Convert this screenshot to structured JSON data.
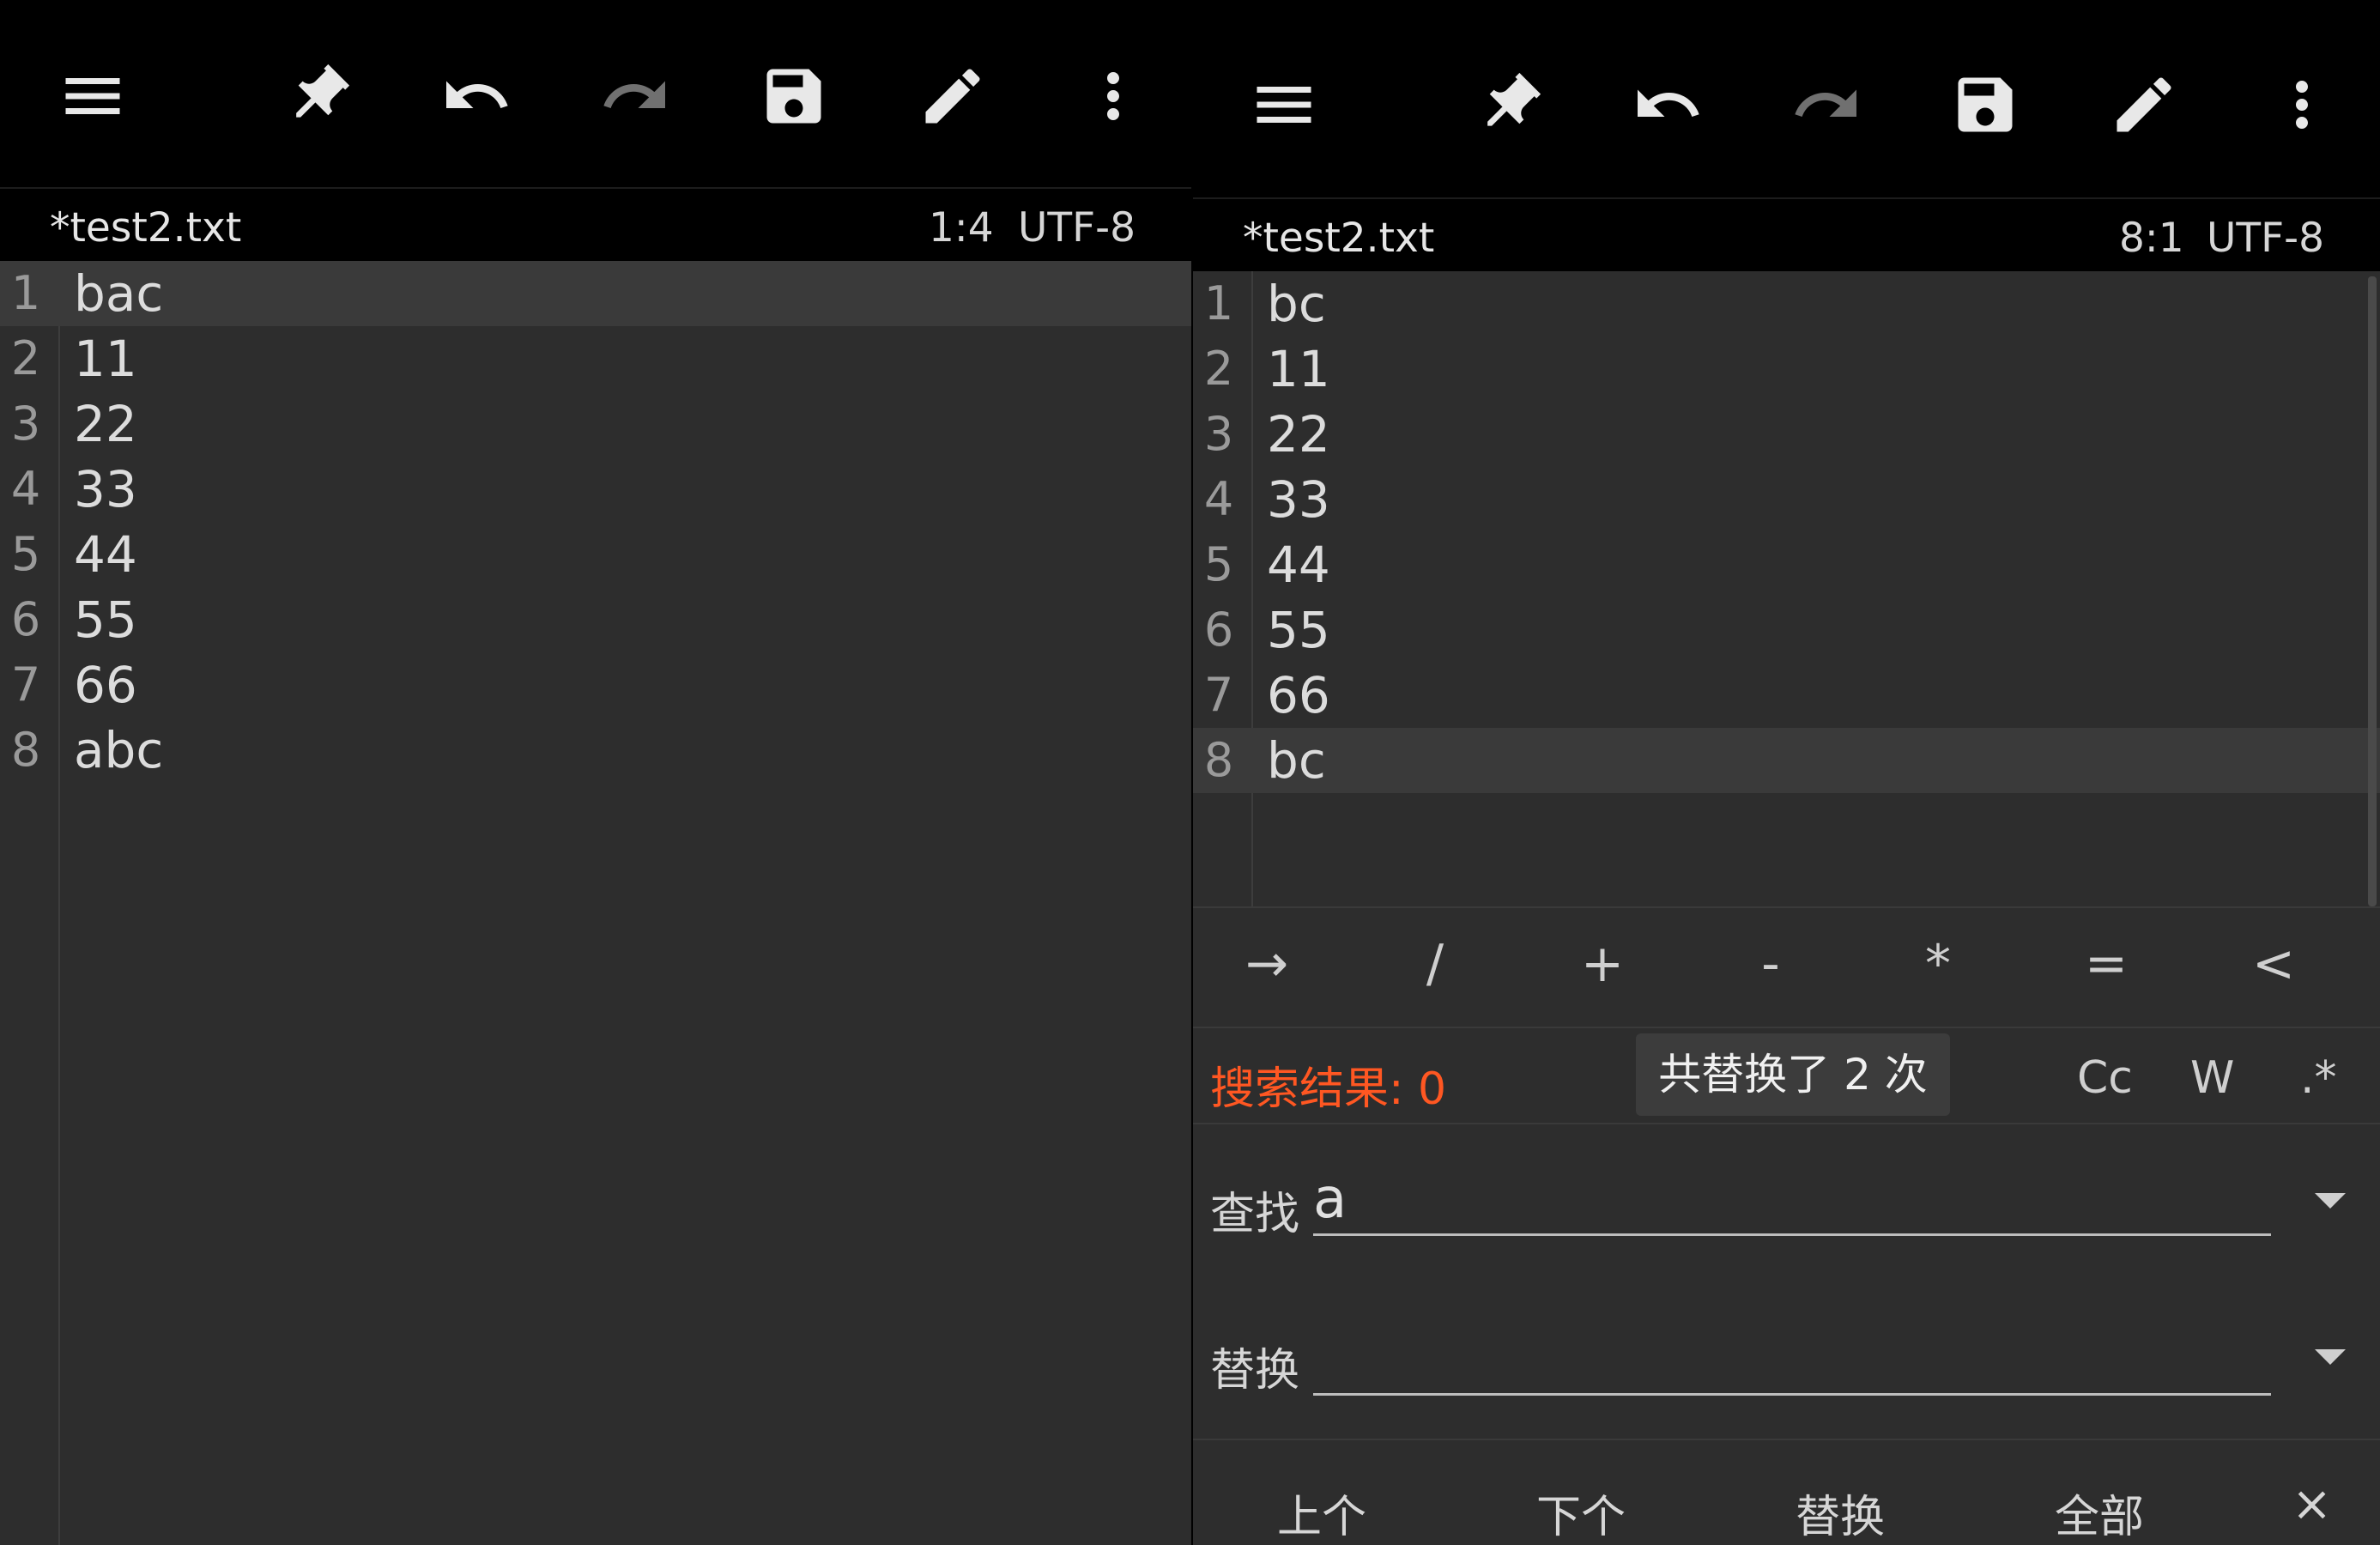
{
  "toolbar": {
    "icons": [
      "menu-icon",
      "pin-icon",
      "undo-icon",
      "redo-icon",
      "save-icon",
      "edit-icon",
      "more-vert-icon"
    ]
  },
  "left": {
    "tab_title": "*test2.txt",
    "cursor_pos": "1:4",
    "encoding": "UTF-8",
    "lines": [
      {
        "no": "1",
        "text": "bac"
      },
      {
        "no": "2",
        "text": "11"
      },
      {
        "no": "3",
        "text": "22"
      },
      {
        "no": "4",
        "text": "33"
      },
      {
        "no": "5",
        "text": "44"
      },
      {
        "no": "6",
        "text": "55"
      },
      {
        "no": "7",
        "text": "66"
      },
      {
        "no": "8",
        "text": "abc"
      }
    ],
    "current_line": 1
  },
  "right": {
    "tab_title": "*test2.txt",
    "cursor_pos": "8:1",
    "encoding": "UTF-8",
    "lines": [
      {
        "no": "1",
        "text": "bc"
      },
      {
        "no": "2",
        "text": "11"
      },
      {
        "no": "3",
        "text": "22"
      },
      {
        "no": "4",
        "text": "33"
      },
      {
        "no": "5",
        "text": "44"
      },
      {
        "no": "6",
        "text": "55"
      },
      {
        "no": "7",
        "text": "66"
      },
      {
        "no": "8",
        "text": "bc"
      }
    ],
    "current_line": 8,
    "symbols": [
      "→",
      "/",
      "+",
      "-",
      "*",
      "=",
      "<"
    ],
    "search": {
      "result_text": "搜索结果: 0",
      "toast": "共替换了 2 次",
      "options": [
        "Cc",
        "W",
        ".*"
      ],
      "find_label": "查找",
      "find_value": "a",
      "replace_label": "替换",
      "replace_value": "",
      "actions": [
        "上个",
        "下个",
        "替换",
        "全部"
      ],
      "close": "×"
    }
  },
  "colors": {
    "toolbar_bg": "#000000",
    "editor_bg": "#2d2d2d",
    "current_line_bg": "#3a3a3a",
    "result_text": "#ff5722"
  }
}
